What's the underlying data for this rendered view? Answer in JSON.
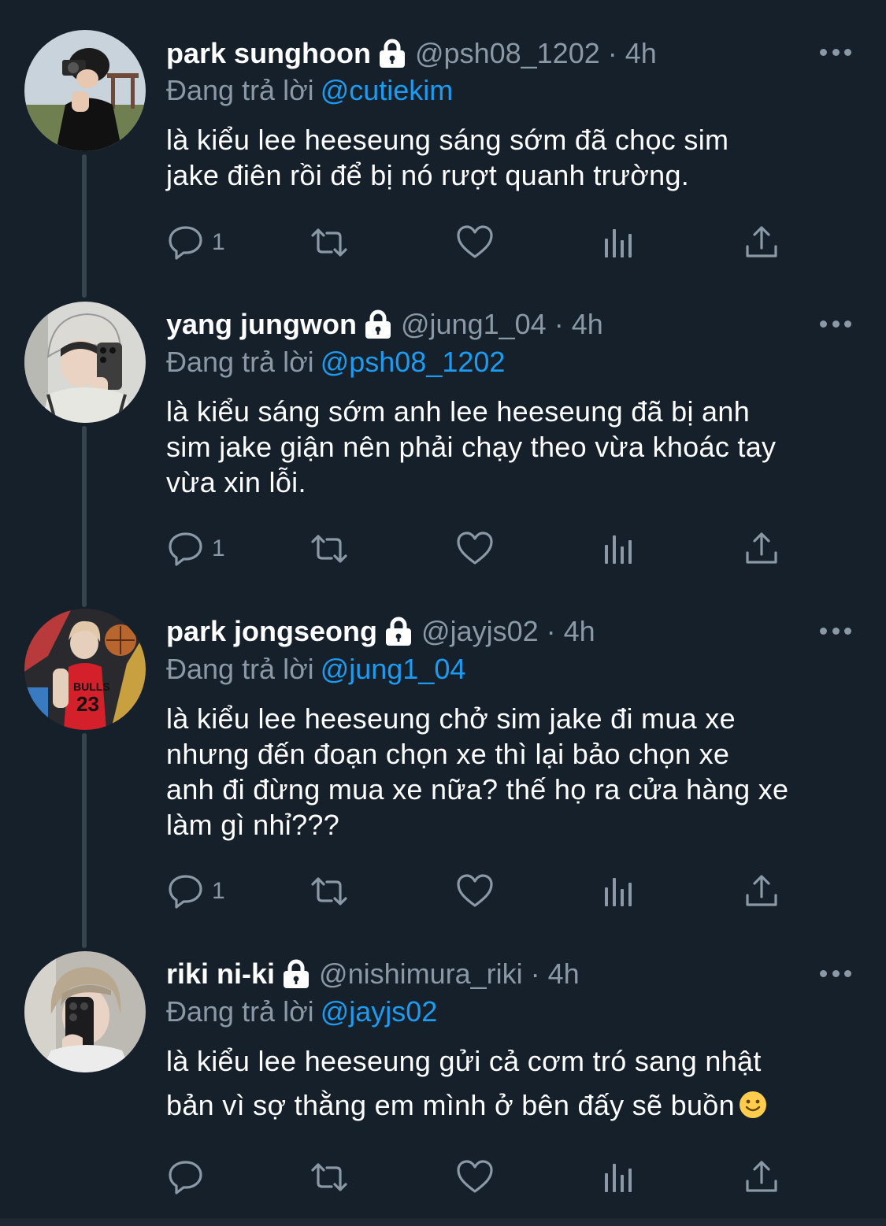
{
  "colors": {
    "background": "#15202b",
    "text": "#ffffff",
    "muted": "#8b98a5",
    "accent": "#1d9bf0"
  },
  "reply_prefix": "Đang trả lời",
  "tweets": [
    {
      "display_name": "park sunghoon",
      "handle": "@psh08_1202",
      "dot": "·",
      "time": "4h",
      "reply_to": "@cutiekim",
      "lines": [
        "là kiểu lee heeseung sáng sớm đã chọc sim",
        "jake điên rồi để bị nó rượt quanh trường."
      ],
      "reply_count": "1",
      "avatar_icon": "avatar-photo"
    },
    {
      "display_name": "yang jungwon",
      "handle": "@jung1_04",
      "dot": "·",
      "time": "4h",
      "reply_to": "@psh08_1202",
      "lines": [
        "là kiểu sáng sớm anh lee heeseung đã bị anh",
        "sim jake giận nên phải chạy theo vừa khoác tay",
        "vừa xin lỗi."
      ],
      "reply_count": "1",
      "avatar_icon": "avatar-photo"
    },
    {
      "display_name": "park jongseong",
      "handle": "@jayjs02",
      "dot": "·",
      "time": "4h",
      "reply_to": "@jung1_04",
      "lines": [
        "là kiểu lee heeseung chở sim jake đi mua xe",
        "nhưng đến đoạn chọn xe thì lại bảo chọn xe",
        "anh đi đừng mua xe nữa? thế họ ra cửa hàng xe",
        "làm gì nhỉ???"
      ],
      "reply_count": "1",
      "avatar_icon": "avatar-photo"
    },
    {
      "display_name": "riki ni-ki",
      "handle": "@nishimura_riki",
      "dot": "·",
      "time": "4h",
      "reply_to": "@jayjs02",
      "lines": [
        "là kiểu lee heeseung gửi cả cơm tró sang nhật",
        "bản vì sợ thằng em mình ở bên đấy sẽ buồn"
      ],
      "reply_count": "",
      "avatar_icon": "avatar-photo",
      "trailing_emoji": "slightly-smiling-face-emoji"
    }
  ]
}
